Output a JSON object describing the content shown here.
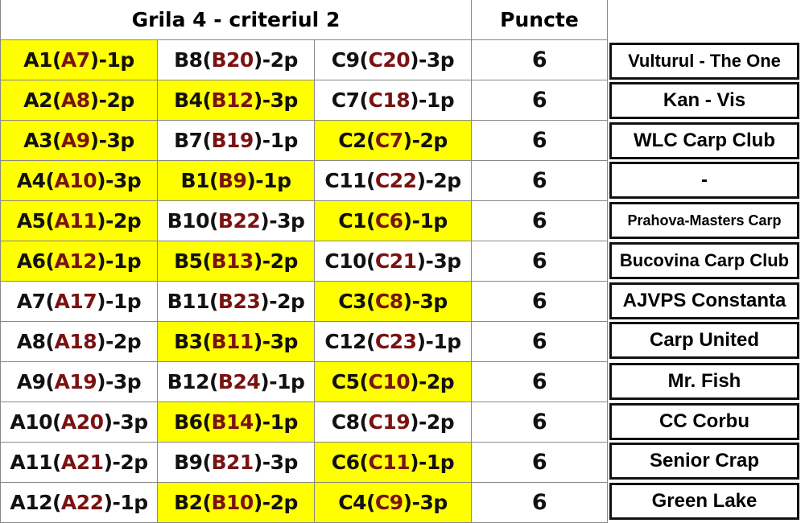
{
  "header": {
    "title": "Grila 4 - criteriul 2",
    "points_label": "Puncte"
  },
  "colors": {
    "highlight": "#ffff00",
    "inner_text": "#7a1212"
  },
  "rows": [
    {
      "cells": [
        {
          "pre": "A1(",
          "inner": "A7",
          "post": ")-1p",
          "hl": true
        },
        {
          "pre": "B8(",
          "inner": "B20",
          "post": ")-2p",
          "hl": false
        },
        {
          "pre": "C9(",
          "inner": "C20",
          "post": ")-3p",
          "hl": false
        }
      ],
      "points": "6",
      "team": "Vulturul - The One"
    },
    {
      "cells": [
        {
          "pre": "A2(",
          "inner": "A8",
          "post": ")-2p",
          "hl": true
        },
        {
          "pre": "B4(",
          "inner": "B12",
          "post": ")-3p",
          "hl": true
        },
        {
          "pre": "C7(",
          "inner": "C18",
          "post": ")-1p",
          "hl": false
        }
      ],
      "points": "6",
      "team": "Kan - Vis"
    },
    {
      "cells": [
        {
          "pre": "A3(",
          "inner": "A9",
          "post": ")-3p",
          "hl": true
        },
        {
          "pre": "B7(",
          "inner": "B19",
          "post": ")-1p",
          "hl": false
        },
        {
          "pre": "C2(",
          "inner": "C7",
          "post": ")-2p",
          "hl": true
        }
      ],
      "points": "6",
      "team": "WLC Carp Club"
    },
    {
      "cells": [
        {
          "pre": "A4(",
          "inner": "A10",
          "post": ")-3p",
          "hl": true
        },
        {
          "pre": "B1(",
          "inner": "B9",
          "post": ")-1p",
          "hl": true
        },
        {
          "pre": "C11(",
          "inner": "C22",
          "post": ")-2p",
          "hl": false
        }
      ],
      "points": "6",
      "team": "-"
    },
    {
      "cells": [
        {
          "pre": "A5(",
          "inner": "A11",
          "post": ")-2p",
          "hl": true
        },
        {
          "pre": "B10(",
          "inner": "B22",
          "post": ")-3p",
          "hl": false
        },
        {
          "pre": "C1(",
          "inner": "C6",
          "post": ")-1p",
          "hl": true
        }
      ],
      "points": "6",
      "team": "Prahova-Masters Carp"
    },
    {
      "cells": [
        {
          "pre": "A6(",
          "inner": "A12",
          "post": ")-1p",
          "hl": true
        },
        {
          "pre": "B5(",
          "inner": "B13",
          "post": ")-2p",
          "hl": true
        },
        {
          "pre": "C10(",
          "inner": "C21",
          "post": ")-3p",
          "hl": false
        }
      ],
      "points": "6",
      "team": "Bucovina Carp Club"
    },
    {
      "cells": [
        {
          "pre": "A7(",
          "inner": "A17",
          "post": ")-1p",
          "hl": false
        },
        {
          "pre": "B11(",
          "inner": "B23",
          "post": ")-2p",
          "hl": false
        },
        {
          "pre": "C3(",
          "inner": "C8",
          "post": ")-3p",
          "hl": true
        }
      ],
      "points": "6",
      "team": "AJVPS Constanta"
    },
    {
      "cells": [
        {
          "pre": "A8(",
          "inner": "A18",
          "post": ")-2p",
          "hl": false
        },
        {
          "pre": "B3(",
          "inner": "B11",
          "post": ")-3p",
          "hl": true
        },
        {
          "pre": "C12(",
          "inner": "C23",
          "post": ")-1p",
          "hl": false
        }
      ],
      "points": "6",
      "team": "Carp United"
    },
    {
      "cells": [
        {
          "pre": "A9(",
          "inner": "A19",
          "post": ")-3p",
          "hl": false
        },
        {
          "pre": "B12(",
          "inner": "B24",
          "post": ")-1p",
          "hl": false
        },
        {
          "pre": "C5(",
          "inner": "C10",
          "post": ")-2p",
          "hl": true
        }
      ],
      "points": "6",
      "team": "Mr. Fish"
    },
    {
      "cells": [
        {
          "pre": "A10(",
          "inner": "A20",
          "post": ")-3p",
          "hl": false
        },
        {
          "pre": "B6(",
          "inner": "B14",
          "post": ")-1p",
          "hl": true
        },
        {
          "pre": "C8(",
          "inner": "C19",
          "post": ")-2p",
          "hl": false
        }
      ],
      "points": "6",
      "team": "CC Corbu"
    },
    {
      "cells": [
        {
          "pre": "A11(",
          "inner": "A21",
          "post": ")-2p",
          "hl": false
        },
        {
          "pre": "B9(",
          "inner": "B21",
          "post": ")-3p",
          "hl": false
        },
        {
          "pre": "C6(",
          "inner": "C11",
          "post": ")-1p",
          "hl": true
        }
      ],
      "points": "6",
      "team": "Senior Crap"
    },
    {
      "cells": [
        {
          "pre": "A12(",
          "inner": "A22",
          "post": ")-1p",
          "hl": false
        },
        {
          "pre": "B2(",
          "inner": "B10",
          "post": ")-2p",
          "hl": true
        },
        {
          "pre": "C4(",
          "inner": "C9",
          "post": ")-3p",
          "hl": true
        }
      ],
      "points": "6",
      "team": "Green Lake"
    }
  ]
}
